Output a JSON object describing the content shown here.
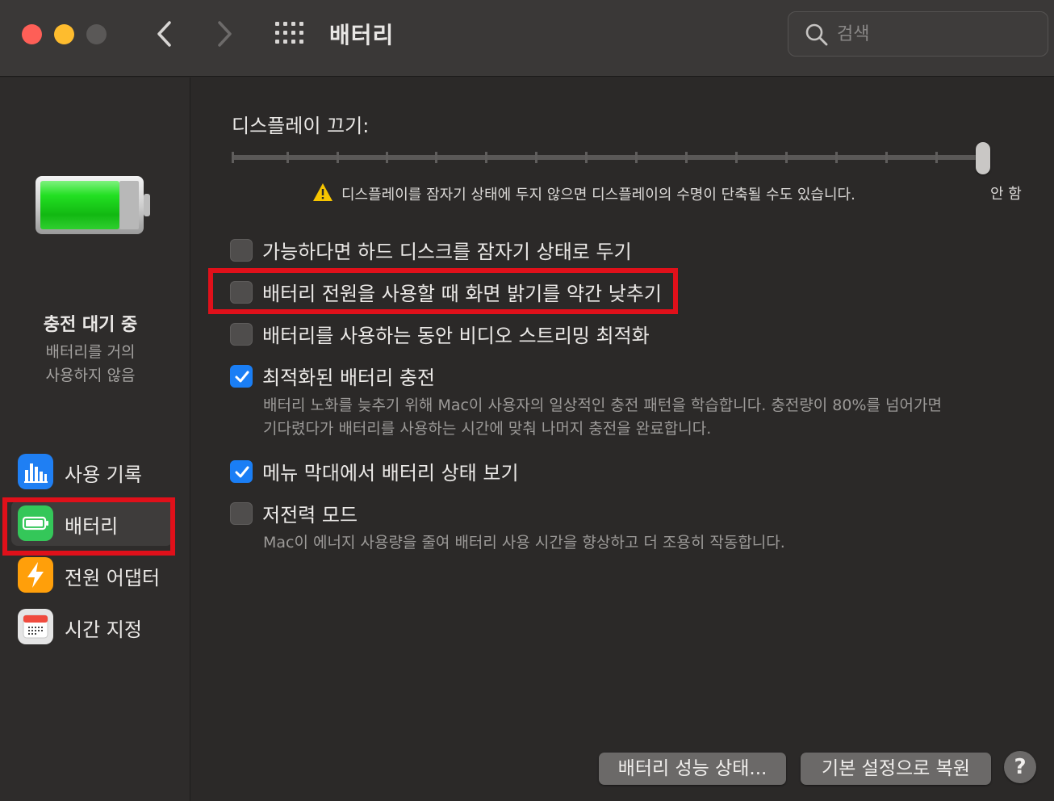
{
  "window": {
    "title": "배터리",
    "search_placeholder": "검색"
  },
  "sidebar": {
    "status_title": "충전 대기 중",
    "status_line1": "배터리를 거의",
    "status_line2": "사용하지 않음",
    "items": [
      {
        "label": "사용 기록",
        "icon": "usage-chart-icon",
        "color": "#1f7ff3"
      },
      {
        "label": "배터리",
        "icon": "battery-icon",
        "color": "#34c759",
        "selected": true
      },
      {
        "label": "전원 어댑터",
        "icon": "lightning-icon",
        "color": "#ff9f0a"
      },
      {
        "label": "시간 지정",
        "icon": "calendar-icon",
        "color": "#e5e5e5"
      }
    ]
  },
  "main": {
    "slider_label": "디스플레이 끄기:",
    "slider_value_label": "안 함",
    "slider_value": 1.0,
    "warning_text": "디스플레이를 잠자기 상태에 두지 않으면 디스플레이의 수명이 단축될 수도 있습니다.",
    "options": [
      {
        "label": "가능하다면 하드 디스크를 잠자기 상태로 두기",
        "checked": false
      },
      {
        "label": "배터리 전원을 사용할 때 화면 밝기를 약간 낮추기",
        "checked": false
      },
      {
        "label": "배터리를 사용하는 동안 비디오 스트리밍 최적화",
        "checked": false
      },
      {
        "label": "최적화된 배터리 충전",
        "checked": true,
        "desc1": "배터리 노화를 늦추기 위해 Mac이 사용자의 일상적인 충전 패턴을 학습합니다. 충전량이 80%를 넘어가면",
        "desc2": "기다렸다가 배터리를 사용하는 시간에 맞춰 나머지 충전을 완료합니다."
      },
      {
        "label": "메뉴 막대에서 배터리 상태 보기",
        "checked": true
      },
      {
        "label": "저전력 모드",
        "checked": false,
        "desc1": "Mac이 에너지 사용량을 줄여 배터리 사용 시간을 향상하고 더 조용히 작동합니다."
      }
    ],
    "buttons": {
      "health": "배터리 성능 상태...",
      "restore": "기본 설정으로 복원",
      "help": "?"
    }
  },
  "colors": {
    "accent": "#1a7ef5",
    "highlight": "#e0101a",
    "battery_green": "#2bd62b"
  }
}
